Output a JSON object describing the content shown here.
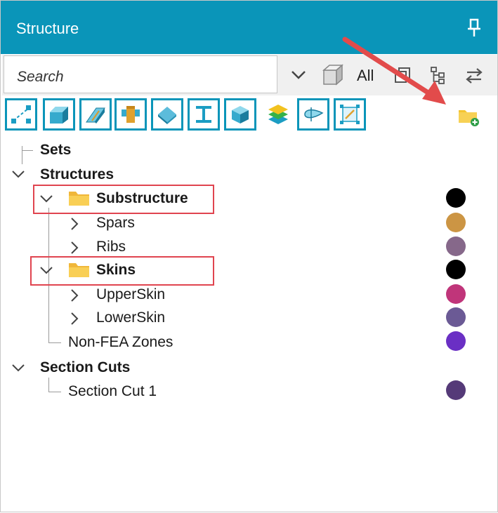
{
  "panel": {
    "title": "Structure"
  },
  "search": {
    "placeholder": "Search"
  },
  "toolbar": {
    "all_label": "All"
  },
  "tree": {
    "sets": "Sets",
    "structures": "Structures",
    "substructure": "Substructure",
    "spars": "Spars",
    "ribs": "Ribs",
    "skins": "Skins",
    "upperskin": "UpperSkin",
    "lowerskin": "LowerSkin",
    "nonfea": "Non-FEA Zones",
    "sectioncuts": "Section Cuts",
    "sectioncut1": "Section Cut 1"
  },
  "colors": {
    "accent": "#0a95b9",
    "highlight": "#e0444f",
    "substructure": "#000000",
    "spars": "#cc9544",
    "ribs": "#86688a",
    "skins": "#000000",
    "upperskin": "#c0357a",
    "lowerskin": "#6b5a95",
    "nonfea": "#6a2fc4",
    "sectioncut1": "#553a78"
  }
}
